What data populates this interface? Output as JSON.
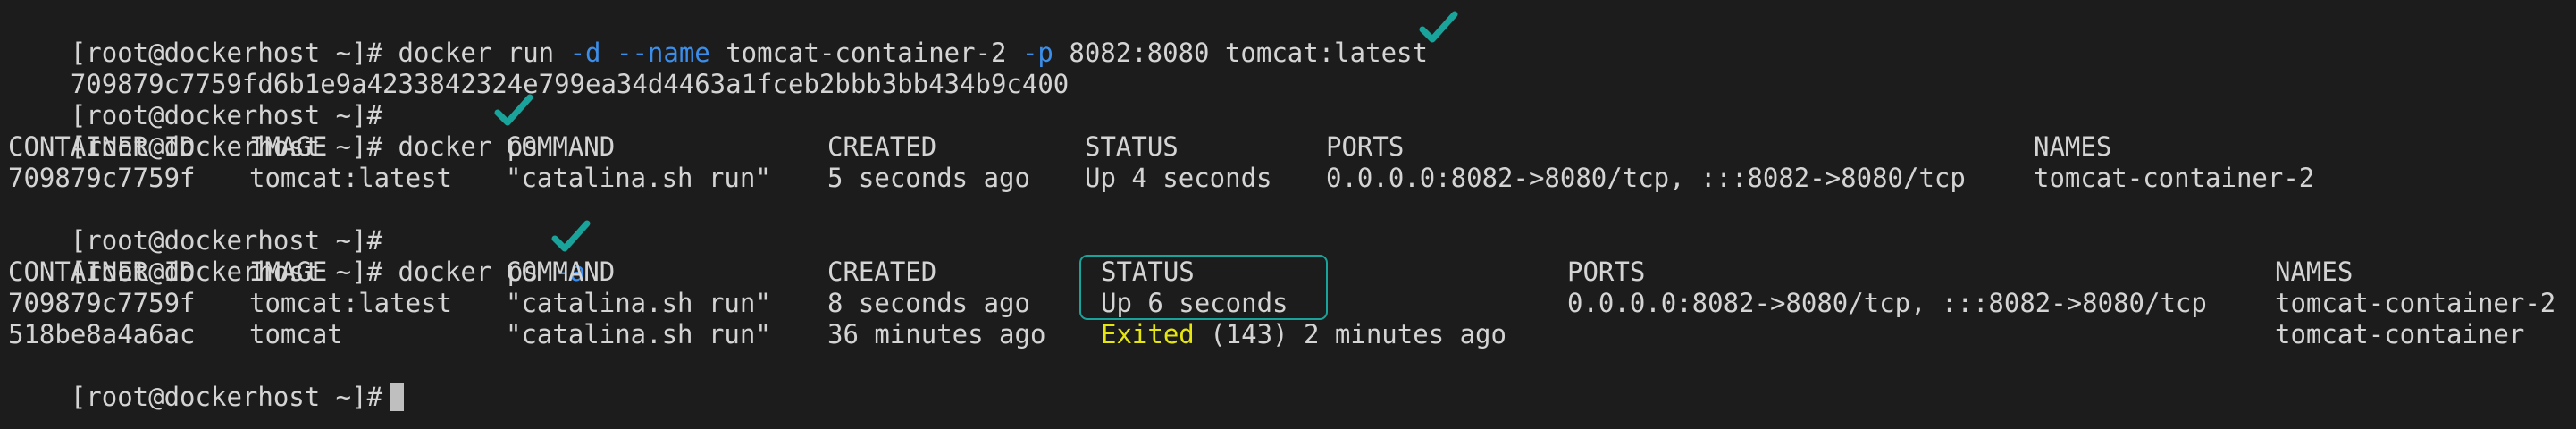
{
  "prompt": "[root@dockerhost ~]#",
  "run_cmd": {
    "base": "docker run",
    "flag_d": "-d",
    "flag_name": "--name",
    "name_value": "tomcat-container-2",
    "flag_p": "-p",
    "port_map": "8082:8080",
    "image": "tomcat:latest"
  },
  "run_output": "709879c7759fd6b1e9a4233842324e799ea34d4463a1fceb2bbb3bb434b9c400",
  "ps_cmd": "docker ps",
  "ps_table": {
    "headers": [
      "CONTAINER ID",
      "IMAGE",
      "COMMAND",
      "CREATED",
      "STATUS",
      "PORTS",
      "NAMES"
    ],
    "rows": [
      [
        "709879c7759f",
        "tomcat:latest",
        "\"catalina.sh run\"",
        "5 seconds ago",
        "Up 4 seconds",
        "0.0.0.0:8082->8080/tcp, :::8082->8080/tcp",
        "tomcat-container-2"
      ]
    ]
  },
  "psa_cmd": {
    "base": "docker ps",
    "flag": "-a"
  },
  "psa_table": {
    "headers": [
      "CONTAINER ID",
      "IMAGE",
      "COMMAND",
      "CREATED",
      "STATUS",
      "PORTS",
      "NAMES"
    ],
    "rows": [
      {
        "id": "709879c7759f",
        "image": "tomcat:latest",
        "command": "\"catalina.sh run\"",
        "created": "8 seconds ago",
        "status": "Up 6 seconds",
        "ports": "0.0.0.0:8082->8080/tcp, :::8082->8080/tcp",
        "name": "tomcat-container-2"
      },
      {
        "id": "518be8a4a6ac",
        "image": "tomcat",
        "command": "\"catalina.sh run\"",
        "created": "36 minutes ago",
        "status_word": "Exited",
        "status_rest": " (143) 2 minutes ago",
        "ports": "",
        "name": "tomcat-container"
      }
    ]
  },
  "colors": {
    "background": "#1c1c1c",
    "text": "#d4d4d4",
    "flag": "#3b8eea",
    "exited": "#e5e510",
    "checkmark": "#1aa39b",
    "highlight_border": "#1aa39b"
  },
  "icons": {
    "checkmark": "check-icon"
  }
}
